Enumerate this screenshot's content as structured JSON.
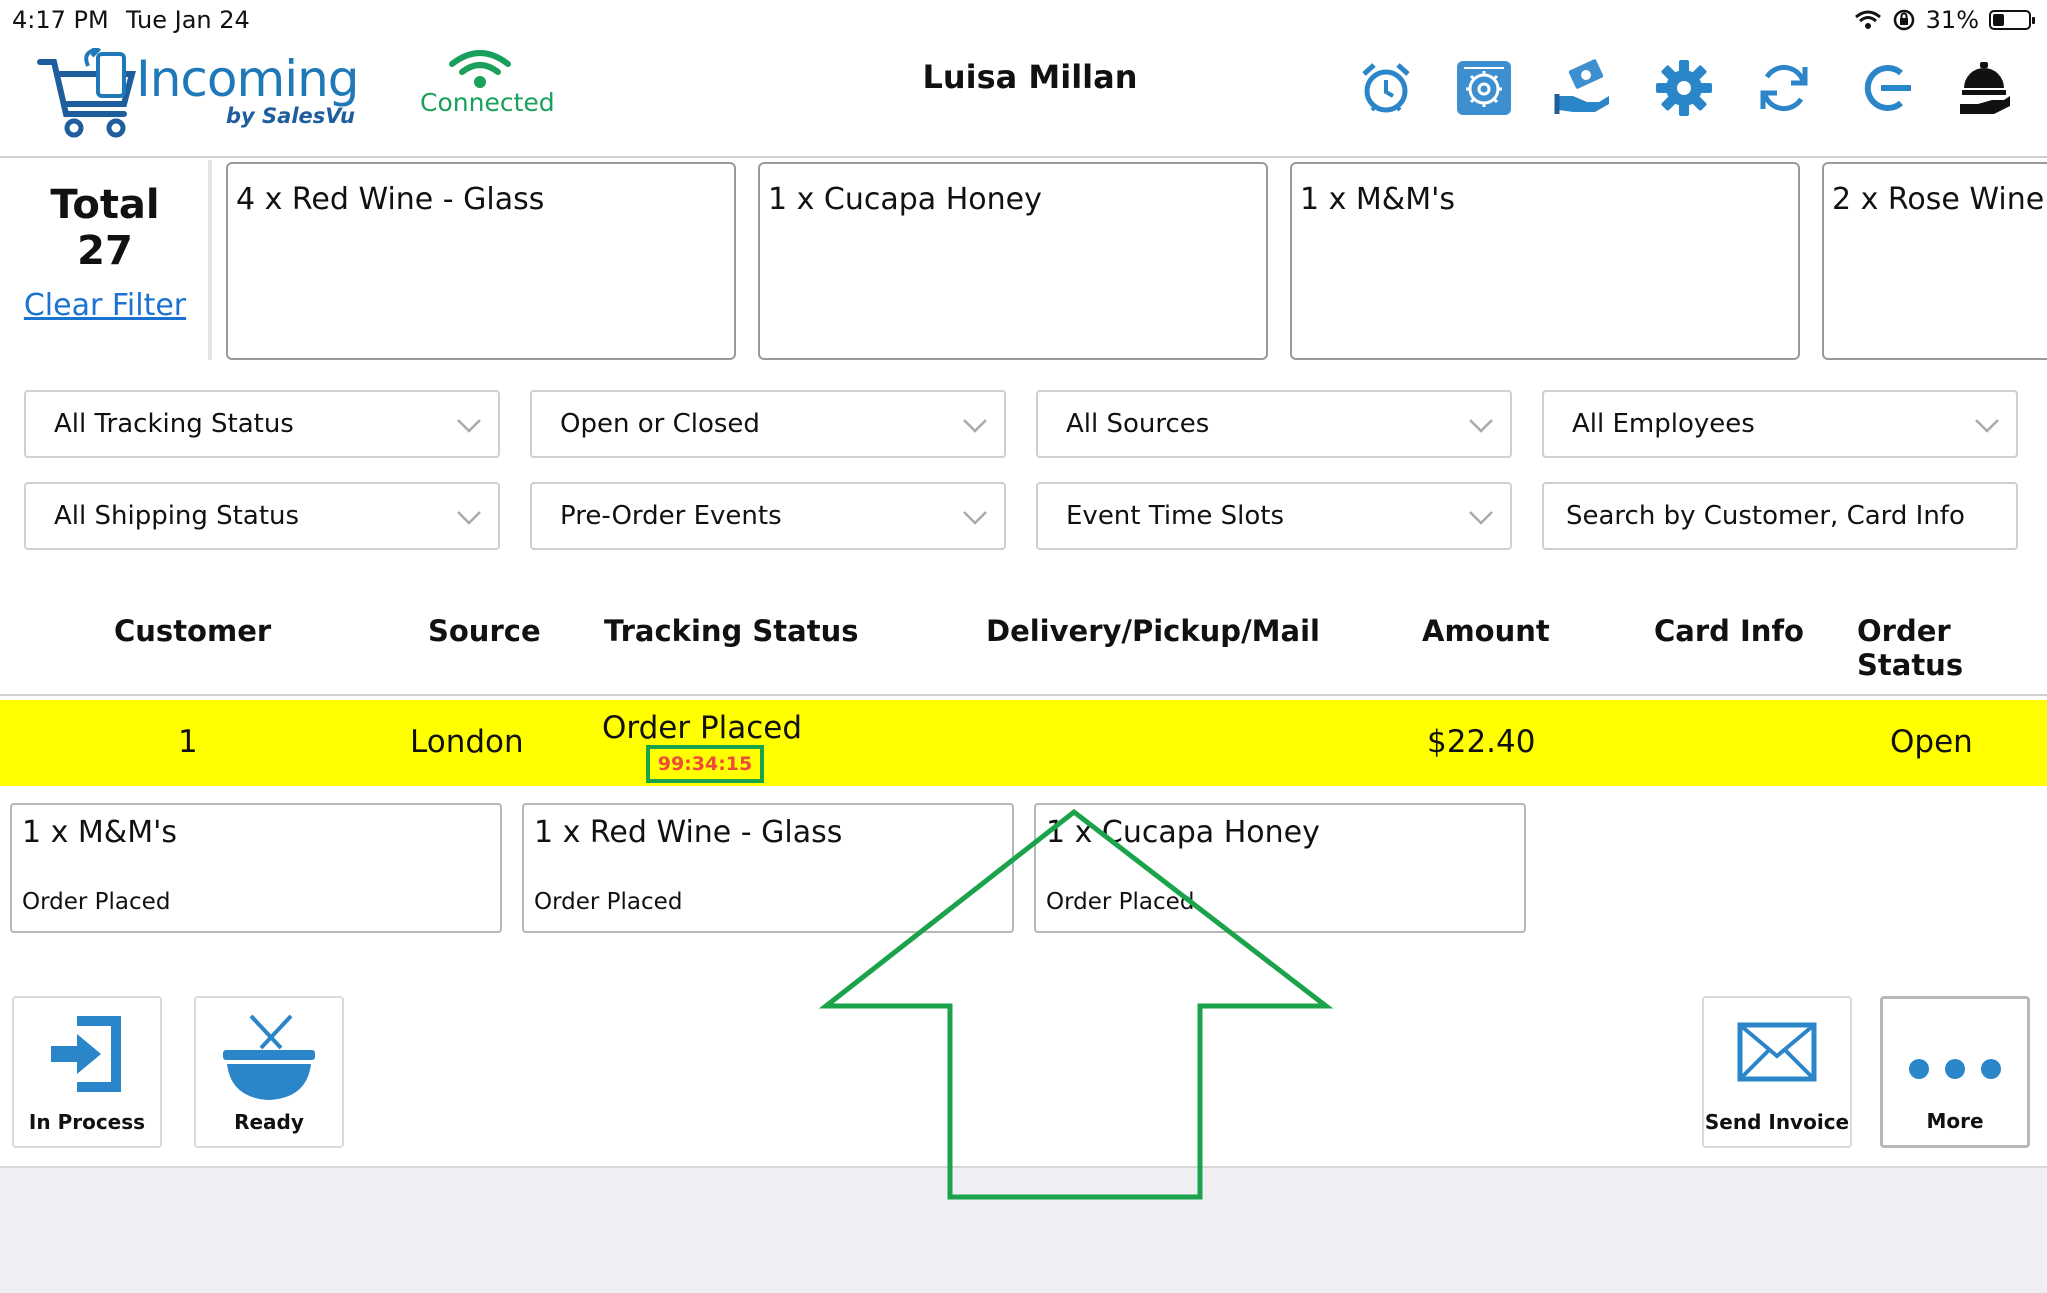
{
  "status_bar": {
    "time": "4:17 PM",
    "date": "Tue Jan 24",
    "battery": "31%",
    "battery_level": 0.31
  },
  "header": {
    "logo_text": "Incoming",
    "logo_sub": "by SalesVu",
    "connection": "Connected",
    "user_name": "Luisa Millan",
    "icons": [
      "alarm-clock-icon",
      "settings-box-icon",
      "cash-hand-icon",
      "gear-icon",
      "refresh-icon",
      "logout-icon",
      "room-service-icon"
    ]
  },
  "summary": {
    "total_label": "Total",
    "total_count": "27",
    "clear_filter": "Clear Filter"
  },
  "top_items": [
    "4 x Red Wine - Glass",
    "1 x Cucapa Honey",
    "1 x M&M's",
    "2 x Rose Wine"
  ],
  "filters": {
    "tracking": "All Tracking Status",
    "open_closed": "Open or Closed",
    "sources": "All Sources",
    "employees": "All Employees",
    "shipping": "All Shipping Status",
    "preorder": "Pre-Order Events",
    "time_slots": "Event Time Slots",
    "search_placeholder": "Search by Customer, Card Info"
  },
  "table": {
    "headers": [
      "Customer",
      "Source",
      "Tracking Status",
      "Delivery/Pickup/Mail",
      "Amount",
      "Card Info",
      "Order Status"
    ],
    "row": {
      "customer": "1",
      "source": "London",
      "tracking": "Order Placed",
      "timer": "99:34:15",
      "amount": "$22.40",
      "order_status": "Open",
      "highlight_color": "#ffff00"
    }
  },
  "order_items": [
    {
      "title": "1 x M&M's",
      "status": "Order Placed"
    },
    {
      "title": "1 x Red Wine - Glass",
      "status": "Order Placed"
    },
    {
      "title": "1 x Cucapa Honey",
      "status": "Order Placed"
    }
  ],
  "actions": {
    "in_process": "In Process",
    "ready": "Ready",
    "send_invoice": "Send Invoice",
    "more": "More"
  },
  "colors": {
    "brand_blue": "#1f78b8",
    "connected_green": "#19a05a",
    "link_blue": "#1a73d0",
    "annotation_green": "#1aa34a",
    "timer_red": "#f04a3a"
  }
}
